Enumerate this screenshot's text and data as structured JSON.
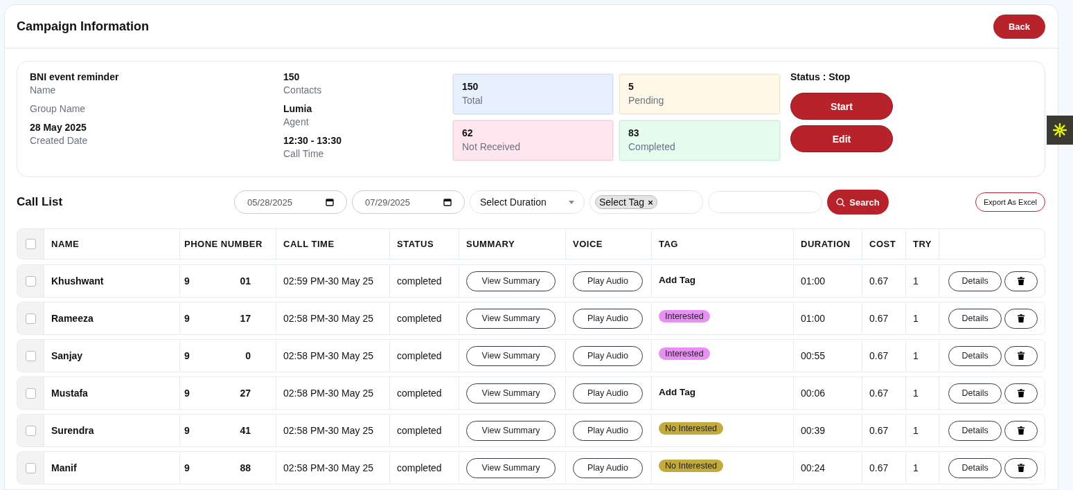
{
  "header": {
    "title": "Campaign Information",
    "back_button": "Back"
  },
  "info": {
    "fields": [
      {
        "value": "BNI event reminder",
        "label": "Name"
      },
      {
        "label": "Group Name"
      },
      {
        "value": "28 May 2025",
        "label": "Created Date"
      }
    ],
    "fields_2": [
      {
        "value": "150",
        "label": "Contacts"
      },
      {
        "value": "Lumia",
        "label": "Agent"
      },
      {
        "value": "12:30 - 13:30",
        "label": "Call Time"
      }
    ],
    "stats": [
      {
        "value": "150",
        "label": "Total",
        "color": "#e7f1fe"
      },
      {
        "value": "5",
        "label": "Pending",
        "color": "#fff8e6"
      },
      {
        "value": "62",
        "label": "Not Received",
        "color": "#ffe6ee"
      },
      {
        "value": "83",
        "label": "Completed",
        "color": "#e6fcef"
      }
    ],
    "status": "Status : Stop",
    "start_button": "Start",
    "edit_button": "Edit"
  },
  "call_list": {
    "title": "Call List",
    "date_from": "05/28/2025",
    "date_to": "07/29/2025",
    "duration_select": "Select Duration",
    "tag_chip": "Select Tag",
    "chip_remove": "×",
    "search_button": "Search",
    "export_button": "Export As Excel"
  },
  "table": {
    "header_checked": false,
    "columns": [
      "NAME",
      "PHONE NUMBER",
      "CALL TIME",
      "STATUS",
      "SUMMARY",
      "VOICE",
      "TAG",
      "DURATION",
      "COST",
      "TRY"
    ],
    "rows": [
      {
        "checked": false,
        "name": "Khushwant",
        "phone_start": "9",
        "phone_end": "01",
        "call_time": "02:59 PM-30 May 25",
        "status": "completed",
        "summary": "View Summary",
        "voice": "Play Audio",
        "tag": {
          "kind": "add",
          "label": "Add Tag"
        },
        "duration": "01:00",
        "cost": "0.67",
        "try": "1",
        "details": "Details"
      },
      {
        "checked": false,
        "name": "Rameeza",
        "phone_start": "9",
        "phone_end": "17",
        "call_time": "02:58 PM-30 May 25",
        "status": "completed",
        "summary": "View Summary",
        "voice": "Play Audio",
        "tag": {
          "kind": "badge",
          "label": "Interested",
          "color": "#e98ef5"
        },
        "duration": "01:00",
        "cost": "0.67",
        "try": "1",
        "details": "Details"
      },
      {
        "checked": false,
        "name": "Sanjay",
        "phone_start": "9",
        "phone_end": "0",
        "call_time": "02:58 PM-30 May 25",
        "status": "completed",
        "summary": "View Summary",
        "voice": "Play Audio",
        "tag": {
          "kind": "badge",
          "label": "Interested",
          "color": "#e98ef5"
        },
        "duration": "00:55",
        "cost": "0.67",
        "try": "1",
        "details": "Details"
      },
      {
        "checked": false,
        "name": "Mustafa",
        "phone_start": "9",
        "phone_end": "27",
        "call_time": "02:58 PM-30 May 25",
        "status": "completed",
        "summary": "View Summary",
        "voice": "Play Audio",
        "tag": {
          "kind": "add",
          "label": "Add Tag"
        },
        "duration": "00:06",
        "cost": "0.67",
        "try": "1",
        "details": "Details"
      },
      {
        "checked": false,
        "name": "Surendra",
        "phone_start": "9",
        "phone_end": "41",
        "call_time": "02:58 PM-30 May 25",
        "status": "completed",
        "summary": "View Summary",
        "voice": "Play Audio",
        "tag": {
          "kind": "badge",
          "label": "No Interested",
          "color": "#c2aa3c"
        },
        "duration": "00:39",
        "cost": "0.67",
        "try": "1",
        "details": "Details"
      },
      {
        "checked": false,
        "name": "Manif",
        "phone_start": "9",
        "phone_end": "88",
        "call_time": "02:58 PM-30 May 25",
        "status": "completed",
        "summary": "View Summary",
        "voice": "Play Audio",
        "tag": {
          "kind": "badge",
          "label": "No Interested",
          "color": "#c2aa3c"
        },
        "duration": "00:24",
        "cost": "0.67",
        "try": "1",
        "details": "Details"
      }
    ]
  }
}
